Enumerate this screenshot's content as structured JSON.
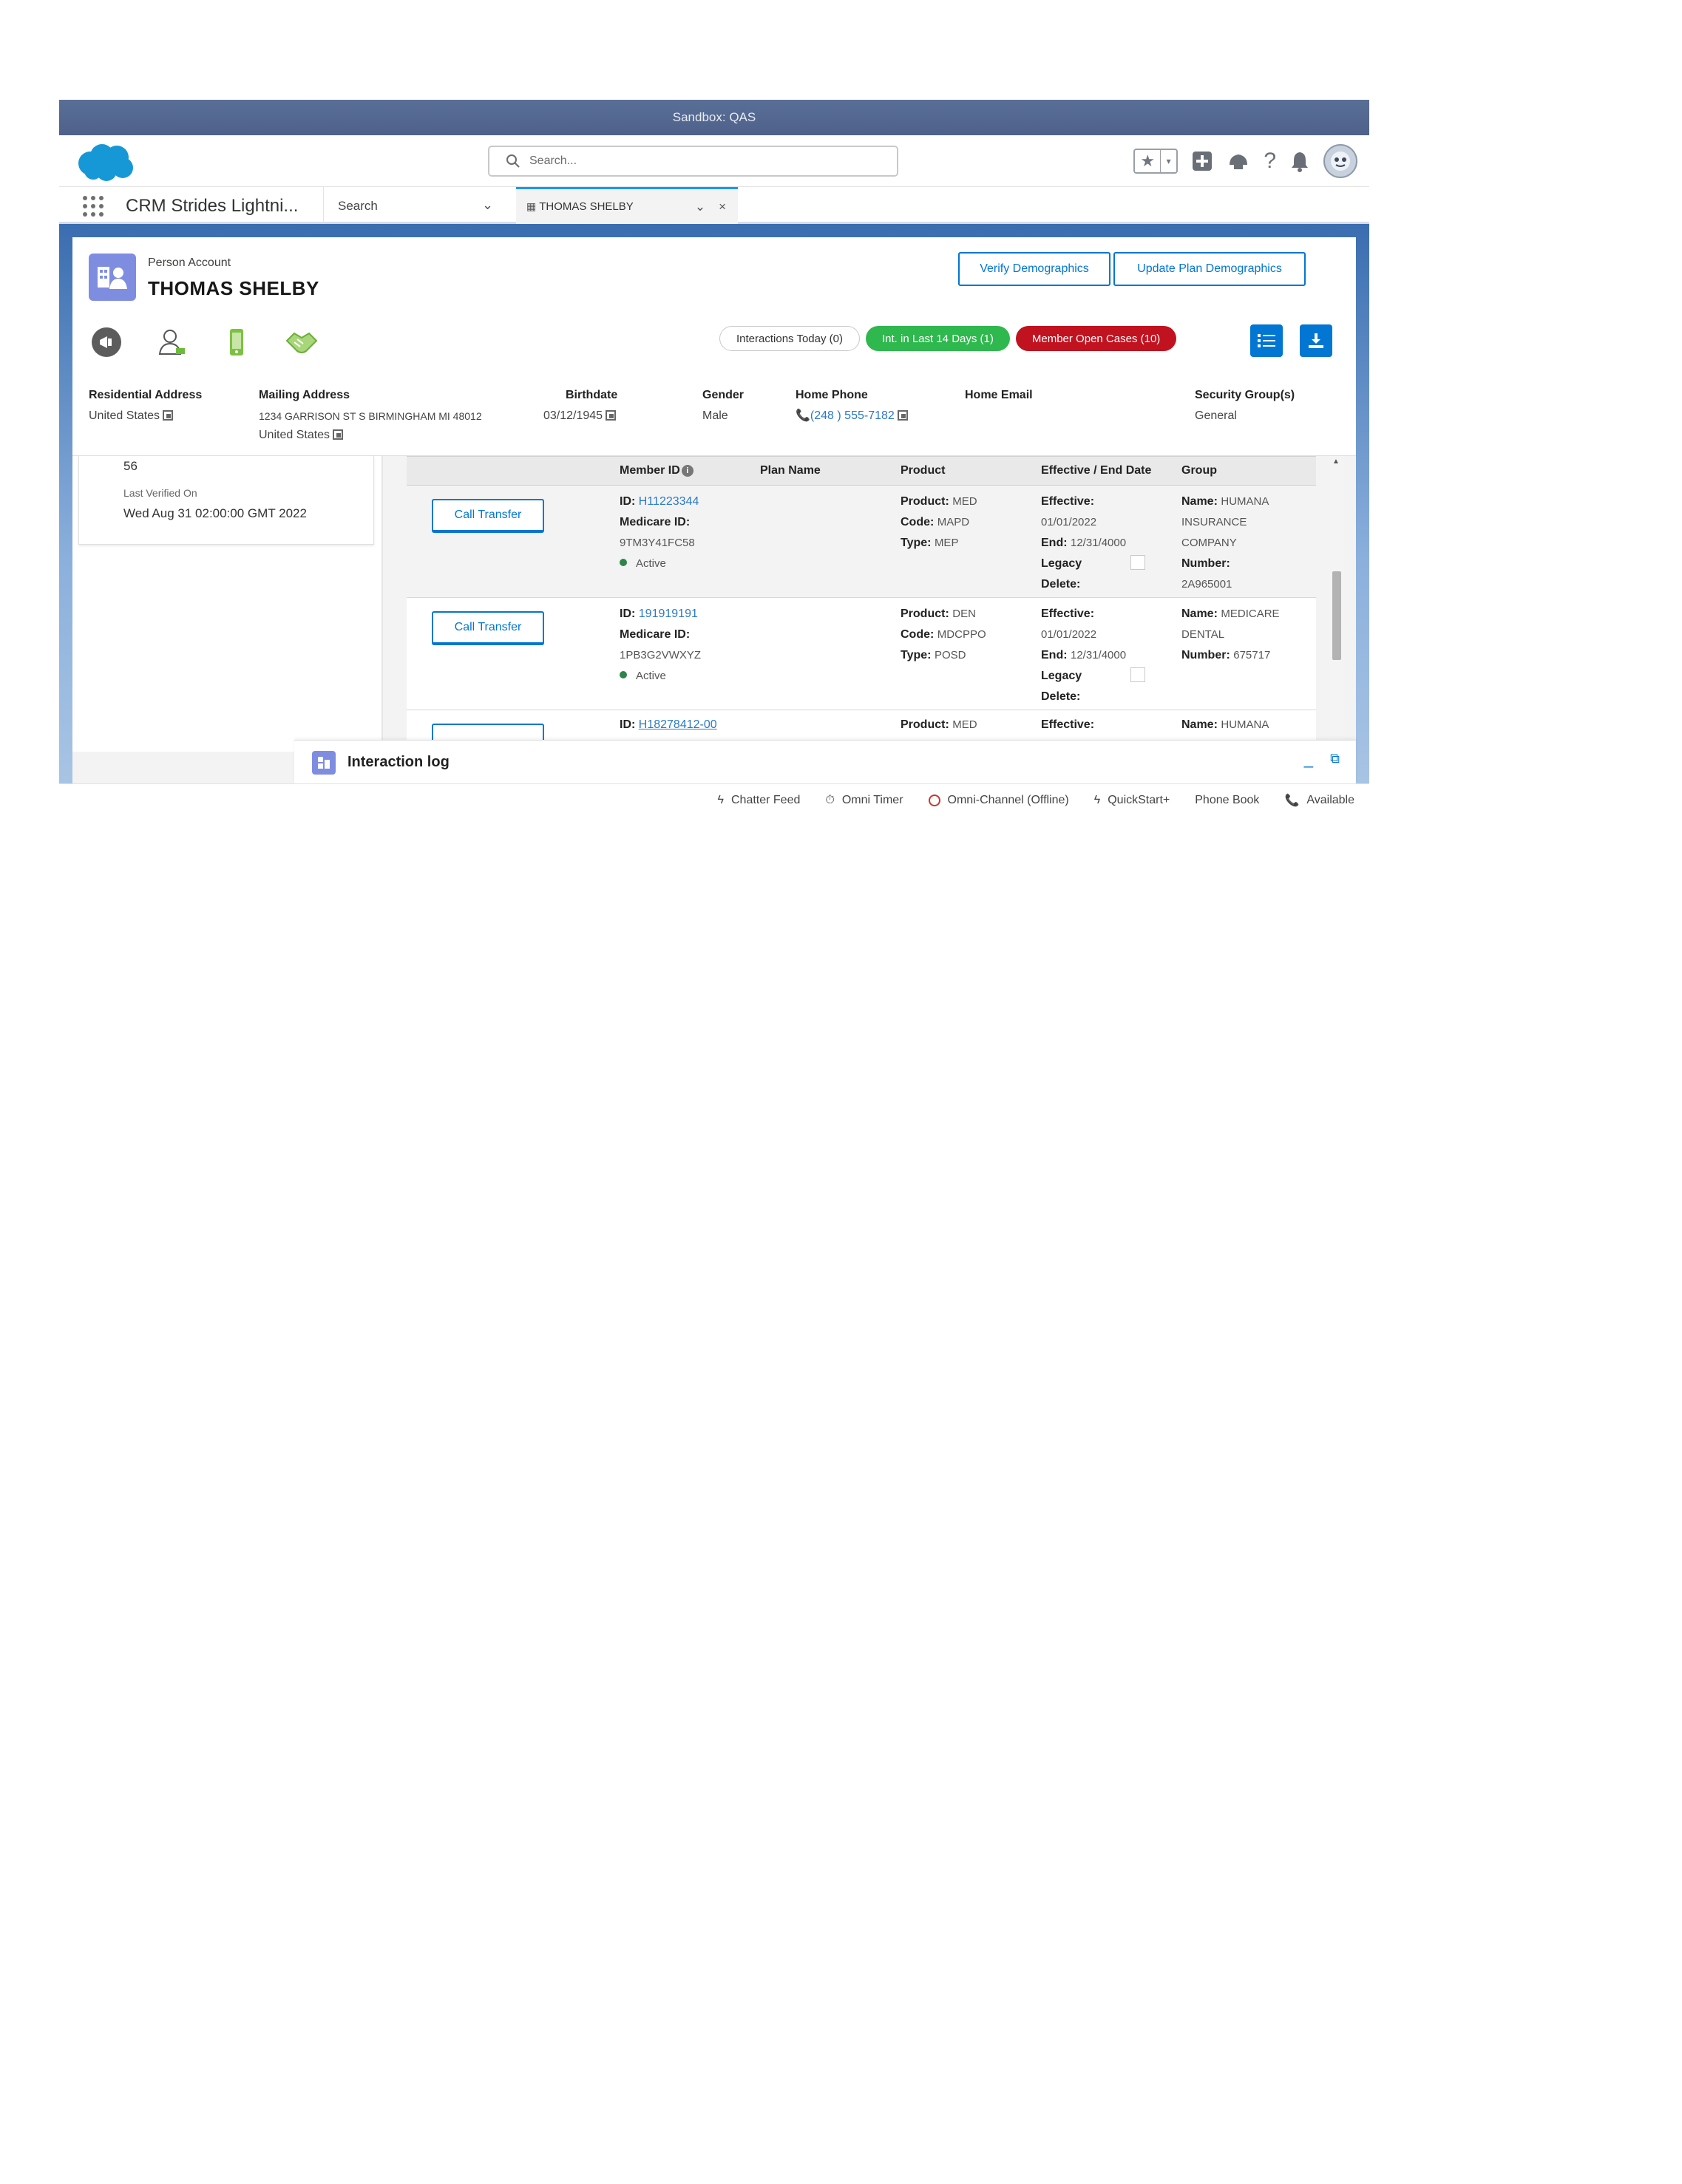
{
  "sandbox_label": "Sandbox: QAS",
  "header": {
    "search_placeholder": "Search...",
    "help_icon": "?"
  },
  "nav": {
    "app_name": "CRM Strides Lightni...",
    "search_label": "Search",
    "tab": {
      "label": "THOMAS SHELBY",
      "close": "×"
    }
  },
  "record": {
    "type": "Person Account",
    "name": "THOMAS SHELBY",
    "buttons": {
      "verify": "Verify Demographics",
      "update": "Update Plan Demographics"
    },
    "badges": {
      "today": "Interactions Today (0)",
      "last14": "Int. in Last 14 Days (1)",
      "open_cases": "Member Open Cases (10)"
    },
    "fields": {
      "residential": {
        "label": "Residential Address",
        "value": "United States"
      },
      "mailing": {
        "label": "Mailing Address",
        "line1": "1234 GARRISON ST S BIRMINGHAM MI 48012",
        "line2": "United States"
      },
      "birthdate": {
        "label": "Birthdate",
        "value": "03/12/1945"
      },
      "gender": {
        "label": "Gender",
        "value": "Male"
      },
      "home_phone": {
        "label": "Home Phone",
        "value": "(248 ) 555-7182"
      },
      "home_email": {
        "label": "Home Email",
        "value": ""
      },
      "security": {
        "label": "Security Group(s)",
        "value": "General"
      }
    }
  },
  "left_panel": {
    "number": "56",
    "verified_label": "Last Verified On",
    "verified_value": "Wed Aug 31 02:00:00 GMT 2022"
  },
  "table": {
    "headers": {
      "member_id": "Member ID",
      "plan_name": "Plan Name",
      "product": "Product",
      "effective": "Effective / End Date",
      "group": "Group"
    },
    "labels": {
      "id": "ID:",
      "medicare_id": "Medicare ID:",
      "product": "Product:",
      "code": "Code:",
      "type": "Type:",
      "effective": "Effective:",
      "end": "End:",
      "legacy": "Legacy",
      "delete": "Delete:",
      "name": "Name:",
      "number": "Number:",
      "call_transfer": "Call Transfer"
    },
    "rows": [
      {
        "id": "H11223344",
        "medicare_id": "9TM3Y41FC58",
        "status": "Active",
        "product": "MED",
        "code": "MAPD",
        "type": "MEP",
        "effective": "01/01/2022",
        "end": "12/31/4000",
        "group_name_1": "HUMANA",
        "group_name_2": "INSURANCE",
        "group_name_3": "COMPANY",
        "group_number": "2A965001"
      },
      {
        "id": "191919191",
        "medicare_id": "1PB3G2VWXYZ",
        "status": "Active",
        "product": "DEN",
        "code": "MDCPPO",
        "type": "POSD",
        "effective": "01/01/2022",
        "end": "12/31/4000",
        "group_name_1": "MEDICARE",
        "group_name_2": "DENTAL",
        "group_number": "675717"
      },
      {
        "id": "H18278412-00",
        "product": "MED",
        "group_name_1": "HUMANA"
      }
    ]
  },
  "interaction_log": {
    "title": "Interaction log"
  },
  "utility_bar": {
    "chatter": "Chatter Feed",
    "timer": "Omni Timer",
    "omni": "Omni-Channel (Offline)",
    "quickstart": "QuickStart+",
    "phonebook": "Phone Book",
    "available": "Available"
  },
  "colors": {
    "brand_blue": "#0176d3",
    "sandbox_bar": "#4d618a",
    "badge_green": "#2fb84e",
    "badge_red": "#c1121f",
    "account_icon": "#7f8de1"
  }
}
